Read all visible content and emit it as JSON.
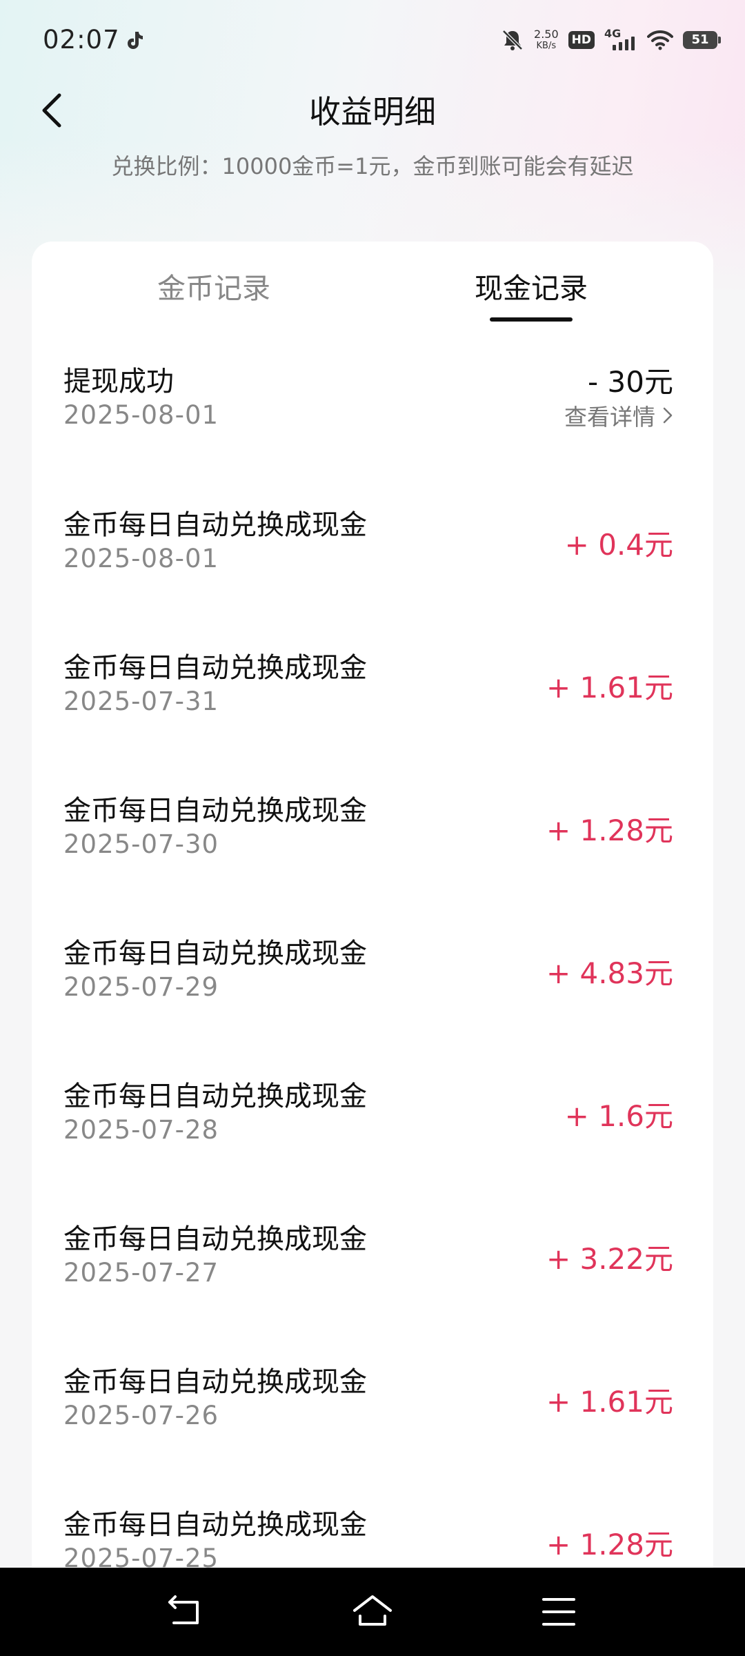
{
  "status_bar": {
    "time": "02:07",
    "speed_value": "2.50",
    "speed_unit": "KB/s",
    "hd_label": "HD",
    "network_label": "4G",
    "battery_level": "51"
  },
  "header": {
    "title": "收益明细",
    "subtitle": "兑换比例：10000金币=1元，金币到账可能会有延迟"
  },
  "tabs": [
    {
      "label": "金币记录",
      "active": false
    },
    {
      "label": "现金记录",
      "active": true
    }
  ],
  "withdrawal": {
    "name": "提现成功",
    "date": "2025-08-01",
    "amount": "-  30元",
    "detail_label": "查看详情"
  },
  "records": [
    {
      "name": "金币每日自动兑换成现金",
      "date": "2025-08-01",
      "amount": "+  0.4元"
    },
    {
      "name": "金币每日自动兑换成现金",
      "date": "2025-07-31",
      "amount": "+  1.61元"
    },
    {
      "name": "金币每日自动兑换成现金",
      "date": "2025-07-30",
      "amount": "+  1.28元"
    },
    {
      "name": "金币每日自动兑换成现金",
      "date": "2025-07-29",
      "amount": "+  4.83元"
    },
    {
      "name": "金币每日自动兑换成现金",
      "date": "2025-07-28",
      "amount": "+  1.6元"
    },
    {
      "name": "金币每日自动兑换成现金",
      "date": "2025-07-27",
      "amount": "+  3.22元"
    },
    {
      "name": "金币每日自动兑换成现金",
      "date": "2025-07-26",
      "amount": "+  1.61元"
    },
    {
      "name": "金币每日自动兑换成现金",
      "date": "2025-07-25",
      "amount": "+  1.28元"
    }
  ],
  "colors": {
    "positive_amount": "#e0345a",
    "text_primary": "#111111",
    "text_secondary": "#888888"
  }
}
